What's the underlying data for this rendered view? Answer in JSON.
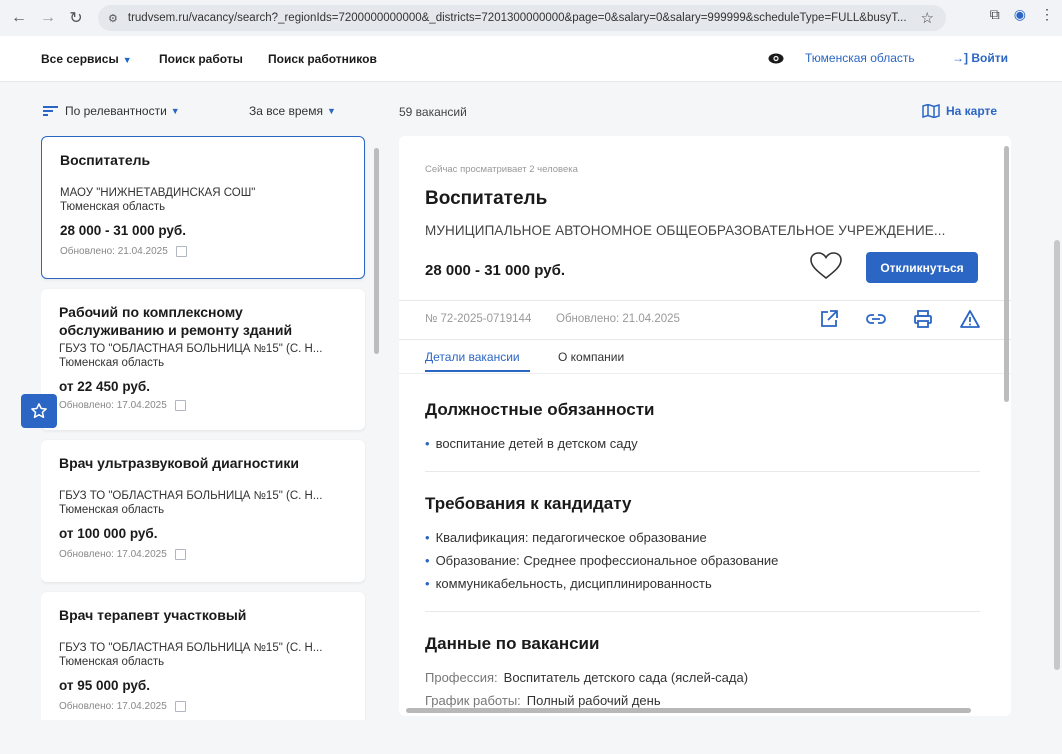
{
  "browser": {
    "url": "trudvsem.ru/vacancy/search?_regionIds=7200000000000&_districts=7201300000000&page=0&salary=0&salary=999999&scheduleType=FULL&busyT..."
  },
  "header": {
    "services_label": "Все сервисы",
    "job_search_label": "Поиск работы",
    "worker_search_label": "Поиск работников",
    "region_label": "Тюменская область",
    "login_label": "Войти"
  },
  "filters": {
    "sort_label": "По релевантности",
    "period_label": "За все время",
    "count_text": "59 вакансий",
    "map_label": "На карте"
  },
  "cards": [
    {
      "title": "Воспитатель",
      "company": "МАОУ \"НИЖНЕТАВДИНСКАЯ СОШ\"",
      "region": "Тюменская область",
      "salary": "28 000 - 31 000 руб.",
      "updated": "Обновлено: 21.04.2025"
    },
    {
      "title": "Рабочий по комплексному обслуживанию и ремонту зданий",
      "company": "ГБУЗ ТО \"ОБЛАСТНАЯ БОЛЬНИЦА №15\" (С. Н...",
      "region": "Тюменская область",
      "salary": "от 22 450 руб.",
      "updated": "Обновлено: 17.04.2025"
    },
    {
      "title": "Врач ультразвуковой диагностики",
      "company": "ГБУЗ ТО \"ОБЛАСТНАЯ БОЛЬНИЦА №15\" (С. Н...",
      "region": "Тюменская область",
      "salary": "от 100 000 руб.",
      "updated": "Обновлено: 17.04.2025"
    },
    {
      "title": "Врач терапевт участковый",
      "company": "ГБУЗ ТО \"ОБЛАСТНАЯ БОЛЬНИЦА №15\" (С. Н...",
      "region": "Тюменская область",
      "salary": "от 95 000 руб.",
      "updated": "Обновлено: 17.04.2025"
    }
  ],
  "detail": {
    "viewing": "Сейчас просматривает 2 человека",
    "title": "Воспитатель",
    "company": "МУНИЦИПАЛЬНОЕ АВТОНОМНОЕ ОБЩЕОБРАЗОВАТЕЛЬНОЕ УЧРЕЖДЕНИЕ...",
    "salary": "28 000 - 31 000 руб.",
    "respond_label": "Откликнуться",
    "number": "№ 72-2025-0719144",
    "updated": "Обновлено: 21.04.2025",
    "tabs": [
      "Детали вакансии",
      "О компании"
    ],
    "duties_title": "Должностные обязанности",
    "duties": [
      "воспитание детей в детском саду"
    ],
    "requirements_title": "Требования к кандидату",
    "requirements": [
      "Квалификация: педагогическое образование",
      "Образование: Среднее профессиональное образование",
      "коммуникабельность, дисциплинированность"
    ],
    "data_title": "Данные по вакансии",
    "data_rows": [
      {
        "label": "Профессия:",
        "value": "Воспитатель детского сада (яслей-сада)"
      },
      {
        "label": "График работы:",
        "value": "Полный рабочий день"
      }
    ]
  },
  "colors": {
    "accent": "#2b66c4",
    "background": "#f5f6f8"
  }
}
